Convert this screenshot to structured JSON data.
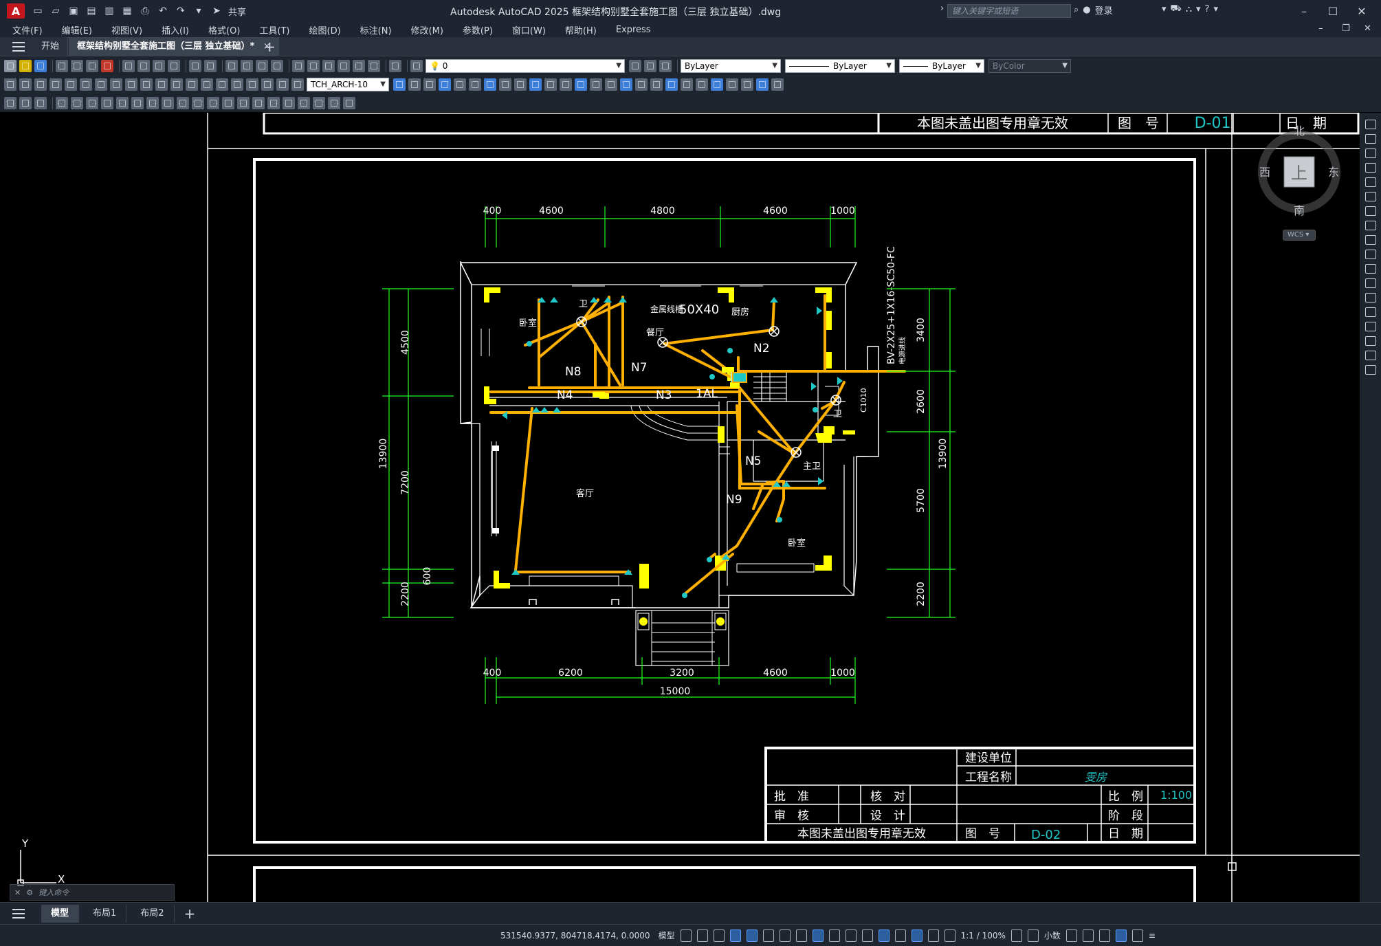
{
  "app": {
    "logo_letter": "A",
    "window_title": "Autodesk AutoCAD 2025    框架结构别墅全套施工图（三层 独立基础）.dwg",
    "share_label": "共享",
    "search_placeholder": "键入关键字或短语",
    "login_label": "登录"
  },
  "menu": [
    "文件(F)",
    "编辑(E)",
    "视图(V)",
    "插入(I)",
    "格式(O)",
    "工具(T)",
    "绘图(D)",
    "标注(N)",
    "修改(M)",
    "参数(P)",
    "窗口(W)",
    "帮助(H)",
    "Express"
  ],
  "tabs": {
    "start": "开始",
    "doc": "框架结构别墅全套施工图（三层 独立基础）*",
    "close": "×",
    "add": "+"
  },
  "toolbar": {
    "layer_value": "0",
    "color_value": "ByLayer",
    "linetype_value": "ByLayer",
    "lineweight_value": "ByLayer",
    "plotstyle_value": "ByColor",
    "dimstyle_value": "TCH_ARCH-10"
  },
  "viewcube": {
    "north": "北",
    "south": "南",
    "east": "东",
    "west": "西",
    "face": "上",
    "wcs": "WCS"
  },
  "drawing": {
    "title_block_top": {
      "seal_note": "本图未盖出图专用章无效",
      "drawing_no_label": "图　号",
      "drawing_no": "D-01",
      "date_label": "日　期"
    },
    "dims_top": [
      "400",
      "4600",
      "4800",
      "4600",
      "1000"
    ],
    "dims_bottom": [
      "400",
      "6200",
      "3200",
      "4600",
      "1000"
    ],
    "dim_bottom_total": "15000",
    "dims_left": [
      "4500",
      "7200",
      "600",
      "2200"
    ],
    "dim_left_total": "13900",
    "dims_right": [
      "3400",
      "2600",
      "5700",
      "2200"
    ],
    "dim_right_total": "13900",
    "rooms": {
      "bedroom_nw": "卧室",
      "bath_n": "卫",
      "dining": "餐厅",
      "kitchen": "厨房",
      "living": "客厅",
      "bath_e": "卫",
      "master_bath": "主卫",
      "bedroom_se": "卧室"
    },
    "circuits": [
      "N8",
      "N7",
      "N4",
      "N3",
      "1AL",
      "N2",
      "N5",
      "N9"
    ],
    "tray_label": "金属线槽",
    "tray_size": "50X40",
    "feeder_label": "BV-2X25+1X16-SC50-FC",
    "feeder_sub": "电源进线",
    "window_code": "C1010",
    "title_block": {
      "client_label": "建设单位",
      "project_label": "工程名称",
      "project_value": "雯房",
      "approve_label": "批　准",
      "check_label": "核　对",
      "review_label": "审　核",
      "design_label": "设　计",
      "scale_label": "比　例",
      "scale_value": "1:100",
      "stage_label": "阶　段",
      "seal_note": "本图未盖出图专用章无效",
      "drawing_no_label": "图　号",
      "drawing_no": "D-02",
      "date_label": "日　期"
    }
  },
  "ucs": {
    "y": "Y",
    "x": "X"
  },
  "cmdline_placeholder": "键入命令",
  "layout_tabs": {
    "model": "模型",
    "layout1": "布局1",
    "layout2": "布局2",
    "add": "+"
  },
  "status": {
    "coords": "531540.9377, 804718.4174, 0.0000",
    "model": "模型",
    "annot_scale": "1:1 / 100%",
    "units": "小数"
  }
}
